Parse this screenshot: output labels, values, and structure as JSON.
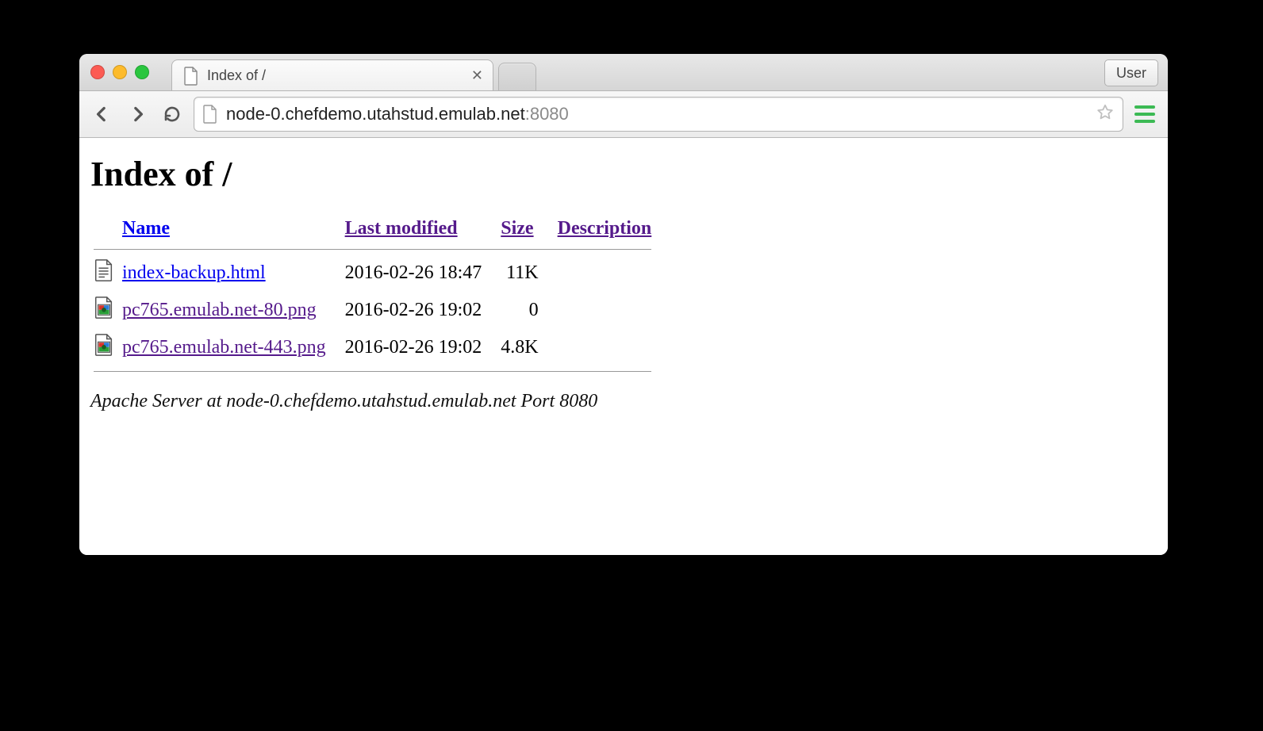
{
  "tab": {
    "title": "Index of /"
  },
  "toolbar": {
    "url_host": "node-0.chefdemo.utahstud.emulab.net",
    "url_port": ":8080",
    "user_label": "User"
  },
  "page": {
    "heading": "Index of /",
    "columns": {
      "name": "Name",
      "last_modified": "Last modified",
      "size": "Size",
      "description": "Description"
    },
    "rows": [
      {
        "icon": "text",
        "name": "index-backup.html",
        "link_class": "bluelink",
        "last_modified": "2016-02-26 18:47",
        "size": "11K",
        "description": ""
      },
      {
        "icon": "image",
        "name": "pc765.emulab.net-80.png",
        "link_class": "",
        "last_modified": "2016-02-26 19:02",
        "size": "0",
        "description": ""
      },
      {
        "icon": "image",
        "name": "pc765.emulab.net-443.png",
        "link_class": "",
        "last_modified": "2016-02-26 19:02",
        "size": "4.8K",
        "description": ""
      }
    ],
    "footer": "Apache Server at node-0.chefdemo.utahstud.emulab.net Port 8080"
  }
}
